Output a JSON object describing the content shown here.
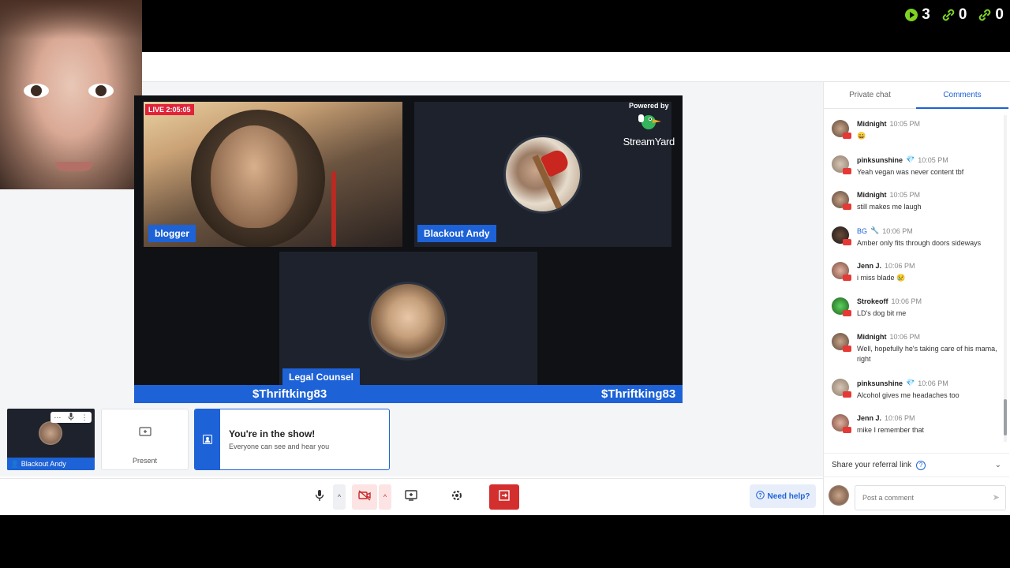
{
  "overlay": {
    "counters": [
      {
        "icon": "play-icon",
        "value": "3",
        "color": "#7ed321"
      },
      {
        "icon": "link-icon",
        "value": "0",
        "color": "#7ed321"
      },
      {
        "icon": "link-icon",
        "value": "0",
        "color": "#7ed321"
      }
    ]
  },
  "stage": {
    "live_badge": "LIVE 2:05:05",
    "powered_by": "Powered by",
    "brand": "StreamYard",
    "participants": [
      "blogger",
      "Blackout Andy",
      "Legal Counsel"
    ],
    "ticker_left": "$Thriftking83",
    "ticker_right": "$Thriftking83"
  },
  "bottom_cards": {
    "self_name": "Blackout Andy",
    "present_label": "Present",
    "notice_title": "You're in the show!",
    "notice_subtitle": "Everyone can see and hear you"
  },
  "toolbar": {
    "help_label": "Need help?"
  },
  "panel": {
    "tabs": [
      "Private chat",
      "Comments"
    ],
    "active_tab": "Comments",
    "comments": [
      {
        "name": "Midnight",
        "time": "10:05 PM",
        "text": "😄"
      },
      {
        "name": "pinksunshine",
        "badge": "💎",
        "time": "10:05 PM",
        "text": "Yeah vegan was never content tbf"
      },
      {
        "name": "Midnight",
        "time": "10:05 PM",
        "text": "still makes me laugh"
      },
      {
        "name": "BG",
        "badge": "🔧",
        "time": "10:06 PM",
        "text": "Amber only fits through doors sideways"
      },
      {
        "name": "Jenn J.",
        "time": "10:06 PM",
        "text": "i miss blade 😢"
      },
      {
        "name": "Strokeoff",
        "time": "10:06 PM",
        "text": "LD's dog bit me"
      },
      {
        "name": "Midnight",
        "time": "10:06 PM",
        "text": "Well, hopefully he's taking care of his mama, right"
      },
      {
        "name": "pinksunshine",
        "badge": "💎",
        "time": "10:06 PM",
        "text": "Alcohol gives me headaches too"
      },
      {
        "name": "Jenn J.",
        "time": "10:06 PM",
        "text": "mike I remember that"
      }
    ],
    "referral": "Share your referral link",
    "post_placeholder": "Post a comment"
  },
  "colors": {
    "brand_blue": "#1d62d6",
    "live_red": "#e0233a",
    "leave_red": "#d32f2f",
    "youtube_red": "#e53935"
  }
}
